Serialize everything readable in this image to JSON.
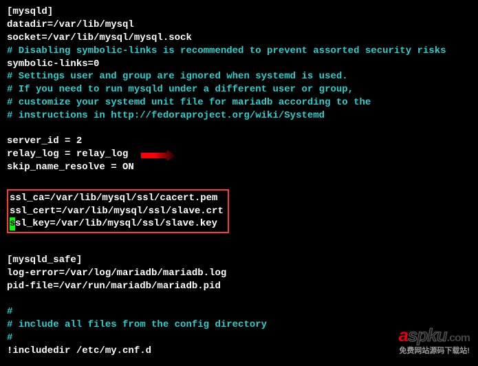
{
  "section1": {
    "header": "[mysqld]",
    "datadir": "datadir=/var/lib/mysql",
    "socket": "socket=/var/lib/mysql/mysql.sock",
    "comment_disable": "# Disabling symbolic-links is recommended to prevent assorted security risks",
    "symbolic": "symbolic-links=0",
    "comment_settings": "# Settings user and group are ignored when systemd is used.",
    "comment_ifyou": "# If you need to run mysqld under a different user or group,",
    "comment_customize": "# customize your systemd unit file for mariadb according to the",
    "comment_instructions": "# instructions in http://fedoraproject.org/wiki/Systemd"
  },
  "server": {
    "server_id": "server_id = 2",
    "relay_log": "relay_log = relay_log",
    "skip_name": "skip_name_resolve = ON"
  },
  "ssl": {
    "ca": "ssl_ca=/var/lib/mysql/ssl/cacert.pem",
    "cert": "ssl_cert=/var/lib/mysql/ssl/slave.crt",
    "key_after": "sl_key=/var/lib/mysql/ssl/slave.key"
  },
  "section2": {
    "header": "[mysqld_safe]",
    "logerror": "log-error=/var/log/mariadb/mariadb.log",
    "pidfile": "pid-file=/var/run/mariadb/mariadb.pid"
  },
  "footer": {
    "hash1": "#",
    "include_comment": "# include all files from the config directory",
    "hash2": "#",
    "includedir": "!includedir /etc/my.cnf.d"
  },
  "watermark": {
    "sub": "免费网站源码下载站!"
  }
}
